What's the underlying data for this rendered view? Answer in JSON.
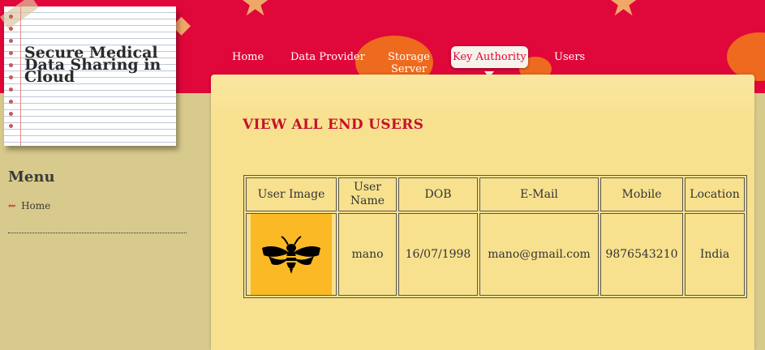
{
  "site": {
    "title": "Secure Medical Data Sharing in Cloud"
  },
  "nav": {
    "items": [
      {
        "label": "Home"
      },
      {
        "label": "Data Provider"
      },
      {
        "label": "Storage Server"
      },
      {
        "label": "Key Authority",
        "active": true
      },
      {
        "label": "Users"
      }
    ]
  },
  "sidebar": {
    "title": "Menu",
    "items": [
      {
        "label": "Home",
        "icon": "arrow-icon"
      }
    ]
  },
  "main": {
    "title": "VIEW ALL END USERS",
    "table": {
      "headers": [
        "User Image",
        "User Name",
        "DOB",
        "E-Mail",
        "Mobile",
        "Location"
      ],
      "rows": [
        {
          "image": "bee-logo",
          "name": "mano",
          "dob": "16/07/1998",
          "email": "mano@gmail.com",
          "mobile": "9876543210",
          "location": "India"
        }
      ]
    }
  },
  "colors": {
    "header": "#e0073a",
    "accent": "#c8102e",
    "content_bg": "#f8e18e",
    "page_bg": "#d8c98c",
    "avatar_bg": "#fbb925"
  }
}
